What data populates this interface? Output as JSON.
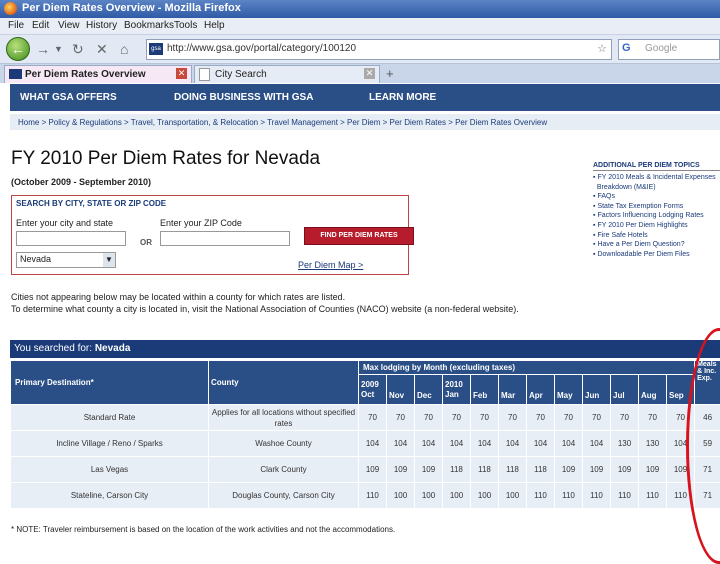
{
  "window": {
    "title": "Per Diem Rates Overview - Mozilla Firefox"
  },
  "menu": [
    "File",
    "Edit",
    "View",
    "History",
    "Bookmarks",
    "Tools",
    "Help"
  ],
  "navbar": {
    "url": "http://www.gsa.gov/portal/category/100120",
    "search_placeholder": "Google",
    "search_engine_glyph": "G"
  },
  "tabs": [
    {
      "label": "Per Diem Rates Overview"
    },
    {
      "label": "City Search"
    }
  ],
  "gsa_nav": [
    "WHAT GSA OFFERS",
    "DOING BUSINESS WITH GSA",
    "LEARN MORE"
  ],
  "breadcrumbs": "Home > Policy & Regulations > Travel, Transportation, & Relocation > Travel Management > Per Diem > Per Diem Rates > Per Diem Rates Overview",
  "page": {
    "title": "FY 2010 Per Diem Rates for Nevada",
    "period": "(October 2009 - September 2010)"
  },
  "search_form": {
    "heading": "SEARCH BY CITY, STATE OR ZIP CODE",
    "city_label": "Enter your city and state",
    "zip_label": "Enter your ZIP Code",
    "or_label": "OR",
    "find_button": "FIND PER DIEM RATES",
    "state_selected": "Nevada",
    "map_link": "Per Diem Map >"
  },
  "sidebar": {
    "heading": "ADDITIONAL PER DIEM TOPICS",
    "items": [
      "FY 2010 Meals & Incidental Expenses",
      "Breakdown (M&IE)",
      "FAQs",
      "State Tax Exemption Forms",
      "Factors Influencing Lodging Rates",
      "FY 2010 Per Diem Highlights",
      "Fire Safe Hotels",
      "Have a Per Diem Question?",
      "Downloadable Per Diem Files"
    ]
  },
  "notes": {
    "line1": "Cities not appearing below may be located within a county for which rates are listed.",
    "line2": "To determine what county a city is located in, visit the National Association of Counties (NACO) website (a non-federal website)."
  },
  "results": {
    "prefix": "You searched for:",
    "query": "Nevada"
  },
  "table": {
    "col_primary": "Primary Destination*",
    "col_county": "County",
    "col_lodging": "Max lodging by Month (excluding taxes)",
    "col_mie": "Meals & Inc. Exp.",
    "year1": "2009",
    "year2": "2010",
    "months": [
      "Oct",
      "Nov",
      "Dec",
      "Jan",
      "Feb",
      "Mar",
      "Apr",
      "May",
      "Jun",
      "Jul",
      "Aug",
      "Sep"
    ],
    "rows": [
      {
        "destination": "Standard Rate",
        "county": "Applies for all locations without specified rates",
        "rates": [
          "70",
          "70",
          "70",
          "70",
          "70",
          "70",
          "70",
          "70",
          "70",
          "70",
          "70",
          "70"
        ],
        "mie": "46"
      },
      {
        "destination": "Incline Village / Reno / Sparks",
        "county": "Washoe County",
        "rates": [
          "104",
          "104",
          "104",
          "104",
          "104",
          "104",
          "104",
          "104",
          "104",
          "130",
          "130",
          "104"
        ],
        "mie": "59"
      },
      {
        "destination": "Las Vegas",
        "county": "Clark County",
        "rates": [
          "109",
          "109",
          "109",
          "118",
          "118",
          "118",
          "118",
          "109",
          "109",
          "109",
          "109",
          "109"
        ],
        "mie": "71"
      },
      {
        "destination": "Stateline, Carson City",
        "county": "Douglas County, Carson City",
        "rates": [
          "110",
          "100",
          "100",
          "100",
          "100",
          "100",
          "110",
          "110",
          "110",
          "110",
          "110",
          "110"
        ],
        "mie": "71"
      }
    ]
  },
  "footnote": "* NOTE: Traveler reimbursement is based on the location of the work activities and not the accommodations."
}
